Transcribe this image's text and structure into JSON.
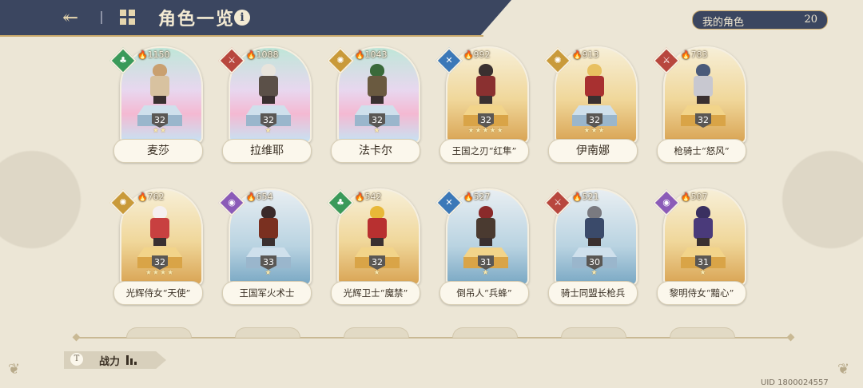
{
  "header": {
    "title": "角色一览",
    "back_icon": "↞",
    "info_icon": "i"
  },
  "roster": {
    "label": "我的角色",
    "count": "20"
  },
  "characters": [
    {
      "name": "麦莎",
      "power": "1150",
      "level": "32",
      "stars": "★★",
      "class": "green",
      "rarity": "rainbow",
      "pedestal": "blue",
      "hair": "#c9a070",
      "outfit": "#d8c2a0"
    },
    {
      "name": "拉维耶",
      "power": "1088",
      "level": "32",
      "stars": "★",
      "class": "red",
      "rarity": "rainbow",
      "pedestal": "blue",
      "hair": "#e8e4dc",
      "outfit": "#5b5048"
    },
    {
      "name": "法卡尔",
      "power": "1043",
      "level": "32",
      "stars": "★",
      "class": "gold",
      "rarity": "rainbow",
      "pedestal": "blue",
      "hair": "#3a6a3a",
      "outfit": "#6a5a40"
    },
    {
      "name": "王国之刃“红隼”",
      "power": "992",
      "level": "32",
      "stars": "★★★★★",
      "class": "blue",
      "rarity": "gold",
      "pedestal": "gold",
      "hair": "#3a3030",
      "outfit": "#8a3030"
    },
    {
      "name": "伊南娜",
      "power": "913",
      "level": "32",
      "stars": "★★★",
      "class": "gold",
      "rarity": "gold",
      "pedestal": "blue",
      "hair": "#e8c060",
      "outfit": "#a83030"
    },
    {
      "name": "枪骑士“怒风”",
      "power": "783",
      "level": "32",
      "stars": "",
      "class": "red",
      "rarity": "gold",
      "pedestal": "gold",
      "hair": "#4a5a7a",
      "outfit": "#c8c8d0"
    },
    {
      "name": "光辉侍女“天使”",
      "power": "762",
      "level": "32",
      "stars": "★★★★",
      "class": "gold",
      "rarity": "gold",
      "pedestal": "gold",
      "hair": "#f5f0f0",
      "outfit": "#c84040"
    },
    {
      "name": "王国军火术士",
      "power": "654",
      "level": "33",
      "stars": "★",
      "class": "purple",
      "rarity": "blue",
      "pedestal": "blue",
      "hair": "#3a2a2a",
      "outfit": "#7a3020"
    },
    {
      "name": "光辉卫士“魔禁”",
      "power": "542",
      "level": "32",
      "stars": "★",
      "class": "green",
      "rarity": "gold",
      "pedestal": "gold",
      "hair": "#e8b838",
      "outfit": "#b83030"
    },
    {
      "name": "倒吊人“兵蜂”",
      "power": "527",
      "level": "31",
      "stars": "★",
      "class": "blue",
      "rarity": "blue",
      "pedestal": "gold",
      "hair": "#8a2a2a",
      "outfit": "#4a3a30"
    },
    {
      "name": "骑士同盟长枪兵",
      "power": "521",
      "level": "30",
      "stars": "★",
      "class": "red",
      "rarity": "blue",
      "pedestal": "blue",
      "hair": "#7a7a80",
      "outfit": "#3a4a6a"
    },
    {
      "name": "黎明侍女“黯心”",
      "power": "507",
      "level": "31",
      "stars": "★",
      "class": "purple",
      "rarity": "gold",
      "pedestal": "gold",
      "hair": "#3a3060",
      "outfit": "#4a3a7a"
    }
  ],
  "footer": {
    "power_sort_label": "战力",
    "sort_icon": "T",
    "uid": "UID 1800024557"
  }
}
